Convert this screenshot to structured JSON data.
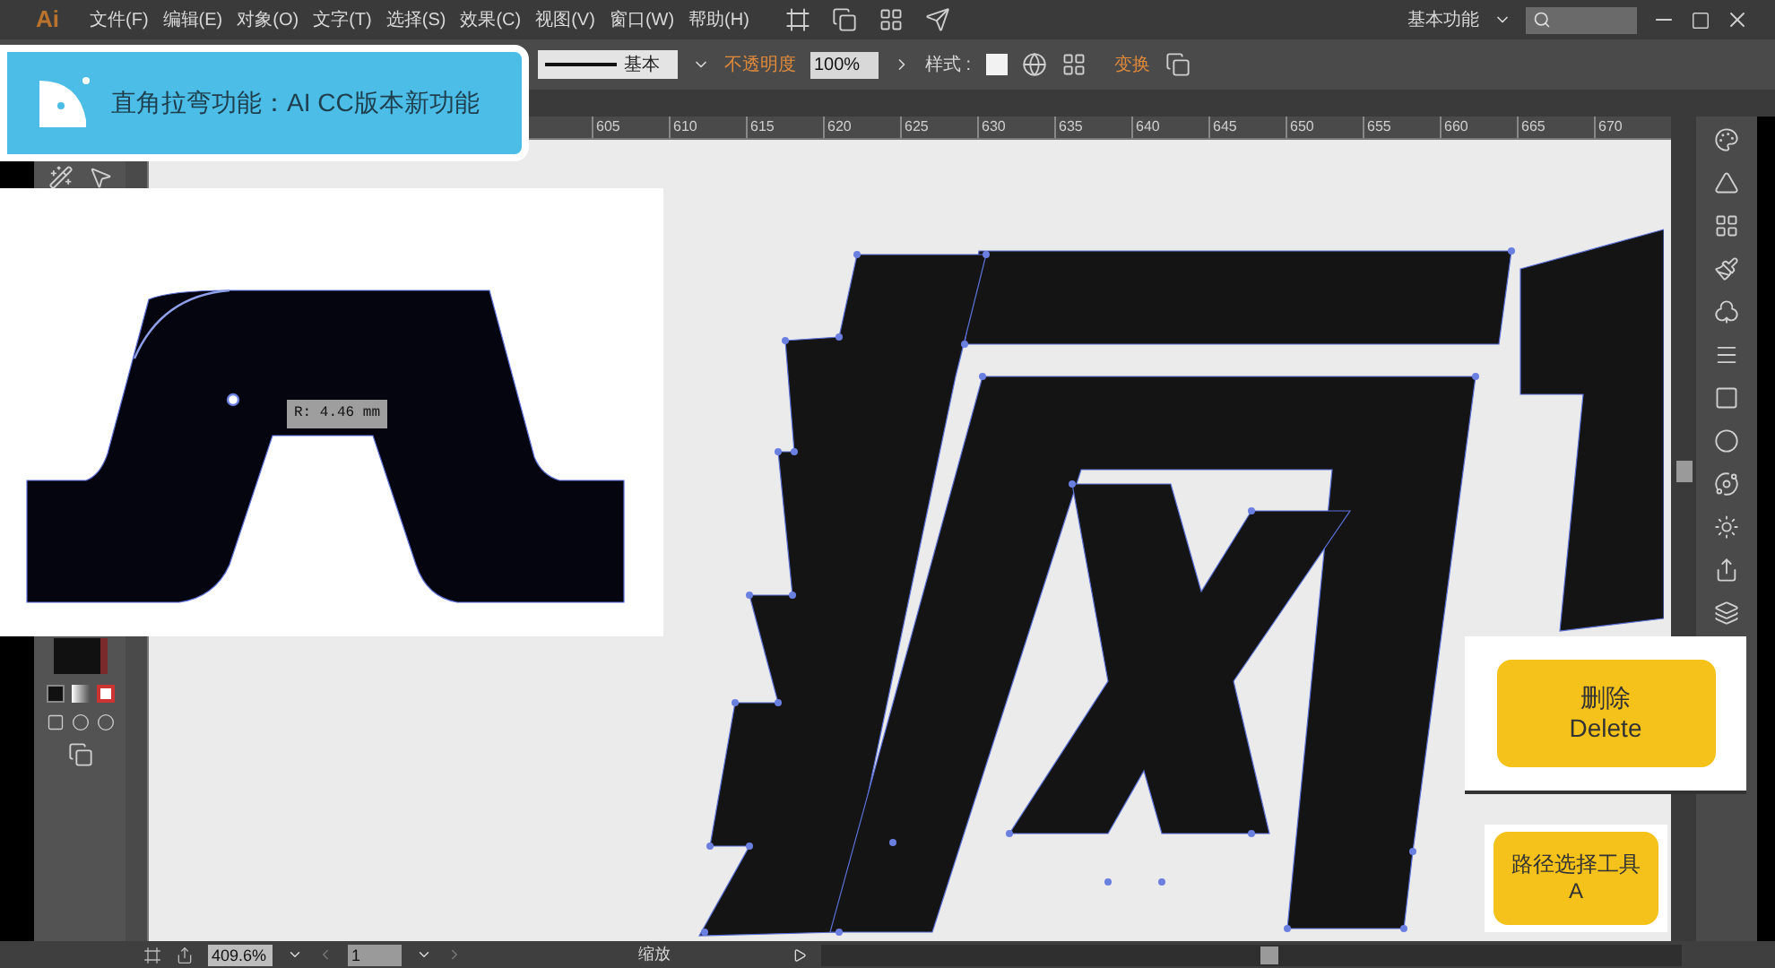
{
  "app": {
    "logo": "Ai"
  },
  "menu": [
    "文件(F)",
    "编辑(E)",
    "对象(O)",
    "文字(T)",
    "选择(S)",
    "效果(C)",
    "视图(V)",
    "窗口(W)",
    "帮助(H)"
  ],
  "workspace": {
    "label": "基本功能"
  },
  "control_bar": {
    "stroke_style": "基本",
    "opacity_label": "不透明度",
    "opacity_value": "100%",
    "style_label": "样式 :",
    "transform_label": "变换"
  },
  "ruler": {
    "ticks": [
      "605",
      "610",
      "615",
      "620",
      "625",
      "630",
      "635",
      "640",
      "645",
      "650",
      "655",
      "660",
      "665",
      "670"
    ]
  },
  "tip_banner": {
    "text": "直角拉弯功能：AI CC版本新功能"
  },
  "inset": {
    "measurement": "R: 4.46 mm"
  },
  "key_hints": [
    {
      "kind": "large",
      "label": "删除",
      "key": "Delete"
    },
    {
      "kind": "small",
      "label": "路径选择工具",
      "key": "A"
    }
  ],
  "status_bar": {
    "zoom": "409.6%",
    "artboard": "1",
    "tool": "缩放"
  }
}
